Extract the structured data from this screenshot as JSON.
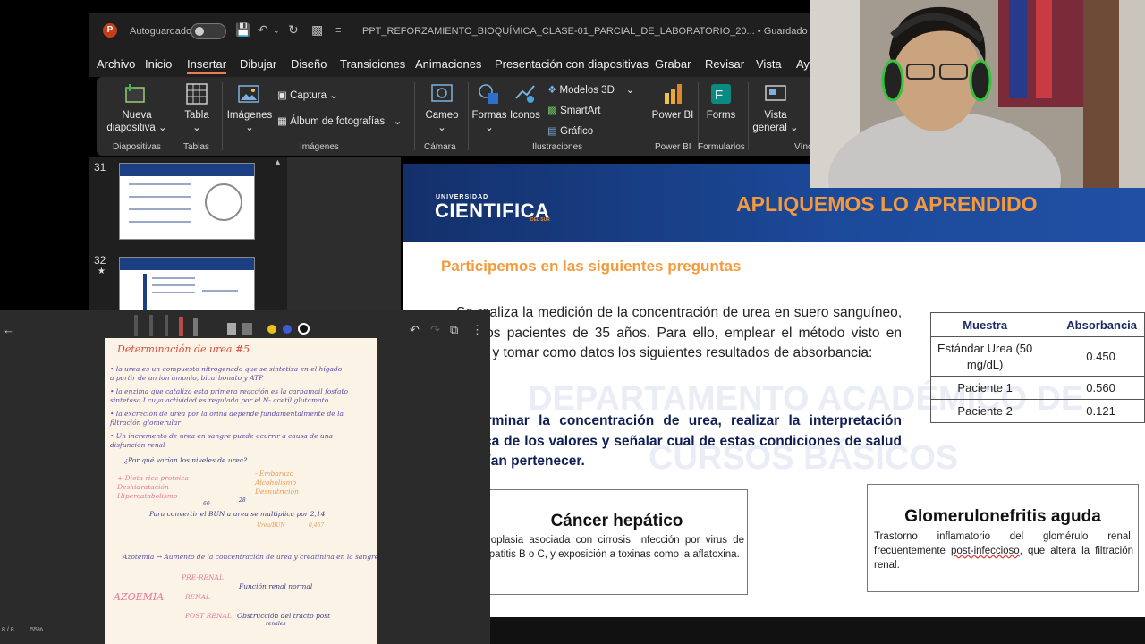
{
  "titlebar": {
    "app_icon": "P",
    "autosave_label": "Autoguardado",
    "filename": "PPT_REFORZAMIENTO_BIOQUÍMICA_CLASE-01_PARCIAL_DE_LABORATORIO_20...",
    "save_status": "• Guardado en Este PC"
  },
  "menu": [
    "Archivo",
    "Inicio",
    "Insertar",
    "Dibujar",
    "Diseño",
    "Transiciones",
    "Animaciones",
    "Presentación con diapositivas",
    "Grabar",
    "Revisar",
    "Vista",
    "Ayu"
  ],
  "ribbon": {
    "nueva": "Nueva diapositiva ⌄",
    "diapositivas": "Diapositivas",
    "tabla": "Tabla",
    "tablas": "Tablas",
    "imagenes_btn": "Imágenes",
    "captura": "Captura ⌄",
    "album": "Álbum de fotografías",
    "imagenes": "Imágenes",
    "cameo": "Cameo",
    "camara": "Cámara",
    "formas": "Formas",
    "iconos": "Iconos",
    "modelos": "Modelos 3D",
    "smartart": "SmartArt",
    "grafico": "Gráfico",
    "ilustraciones": "Ilustraciones",
    "powerbi_btn": "Power BI",
    "powerbi": "Power BI",
    "forms_btn": "Forms",
    "formularios": "Formularios",
    "vista_general": "Vista general ⌄",
    "vinc": "Vínc"
  },
  "thumbnails": {
    "slide31_num": "31",
    "slide32_num": "32",
    "slide32_star": "★"
  },
  "slide": {
    "univ_small": "UNIVERSIDAD",
    "univ_big": "CIENTIFICA",
    "univ_sub": "DEL SUR",
    "title": "APLIQUEMOS LO APRENDIDO",
    "subtitle": "Participemos en las siguientes preguntas",
    "paragraph": "Se realiza la medición de la concentración de urea en suero sanguíneo, en dos pacientes de 35 años. Para ello, emplear el método visto en clase y tomar como datos los siguientes resultados de absorbancia:",
    "question": "Determinar la concentración de urea, realizar la interpretación clínica de los valores y señalar cual de estas condiciones de salud podrían pertenecer.",
    "watermark1": "DEPARTAMENTO ACADÉMICO DE",
    "watermark2": "CURSOS BÁSICOS",
    "table": {
      "headers": [
        "Muestra",
        "Absorbancia"
      ],
      "rows": [
        [
          "Estándar Urea (50 mg/dL)",
          "0.450"
        ],
        [
          "Paciente 1",
          "0.560"
        ],
        [
          "Paciente 2",
          "0.121"
        ]
      ]
    },
    "card1": {
      "title": "Cáncer hepático",
      "desc": "Neoplasia asociada con cirrosis, infección por virus de hepatitis B o C, y exposición a toxinas como la aflatoxina."
    },
    "card2": {
      "title": "Glomerulonefritis aguda",
      "desc_pre": "Trastorno inflamatorio del glomérulo renal, frecuentemente ",
      "desc_link": "post-infeccioso",
      "desc_post": ", que altera la filtración renal."
    }
  },
  "notes": {
    "page": "8 / 8",
    "zoom": "55%",
    "title": "Determinación de urea  #5",
    "lines": [
      "• la urea es un compuesto nitrogenado que se sintetiza en el hígado",
      "  a partir de un ion amonio, bicarbonato y ATP",
      "• la enzima que cataliza esta primera reacción es la carbamoil fosfato",
      "  sintetasa I cuya actividad es regulada por el N- acetil glutamato",
      "• la excreción de urea por la orina depende fundamentalmente de la",
      "  filtración glomerular",
      "• Un incremento de urea en sangre puede ocurrir a causa de una",
      "  disfunción renal"
    ],
    "question": "¿Por qué varían los niveles de urea?",
    "causes_left": [
      "+ Dieta rica proteica",
      "  Deshidratación",
      "  Hipercatabolismo"
    ],
    "causes_right": [
      "- Embarazo",
      "  Alcoholismo",
      "  Desnutrición"
    ],
    "convert": "Para convertir el BUN a urea se multiplica por 2,14",
    "convert_sub": "Urea/BUN",
    "n60": "60",
    "n28": "28",
    "n0467": "0,467",
    "azotemia_def": "Azotemia → Aumento de la concentración de urea y creatinina en la sangre",
    "prerenal": "PRE-RENAL",
    "renal": "RENAL",
    "postrenal": "POST RENAL",
    "azotemia": "AZOEMIA",
    "funcion": "Función renal normal",
    "obstruccion": "Obstrucción del tracto post",
    "obstruccion2": "renales"
  },
  "colors": {
    "accent_orange": "#f59a3c",
    "header_blue": "#1c4a9b",
    "tab_underline": "#e97e5b",
    "pen_yellow": "#e9c21b",
    "pen_blue": "#3d5bd8"
  }
}
